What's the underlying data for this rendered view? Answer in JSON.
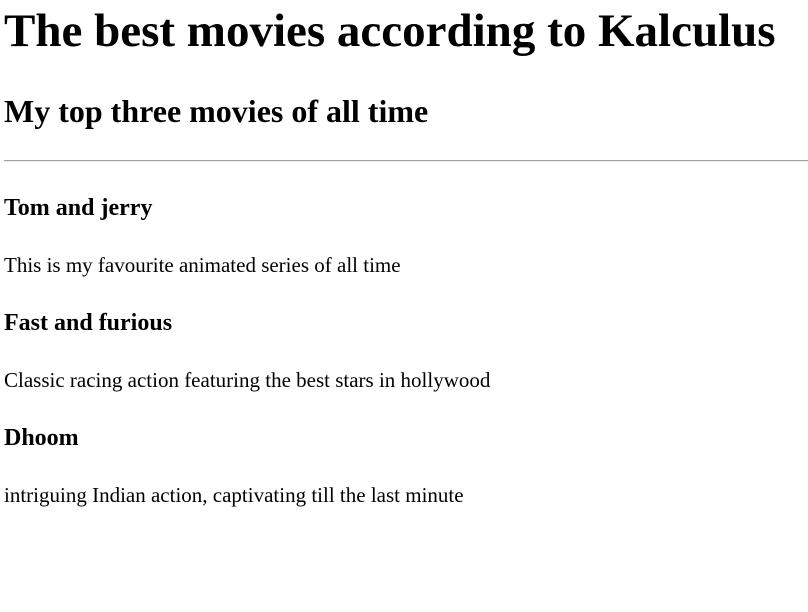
{
  "header": {
    "title": "The best movies according to Kalculus",
    "subtitle": "My top three movies of all time"
  },
  "movies": [
    {
      "title": "Tom and jerry",
      "description": "This is my favourite animated series of all time"
    },
    {
      "title": "Fast and furious",
      "description": "Classic racing action featuring the best stars in hollywood"
    },
    {
      "title": "Dhoom",
      "description": "intriguing Indian action, captivating till the last minute"
    }
  ]
}
